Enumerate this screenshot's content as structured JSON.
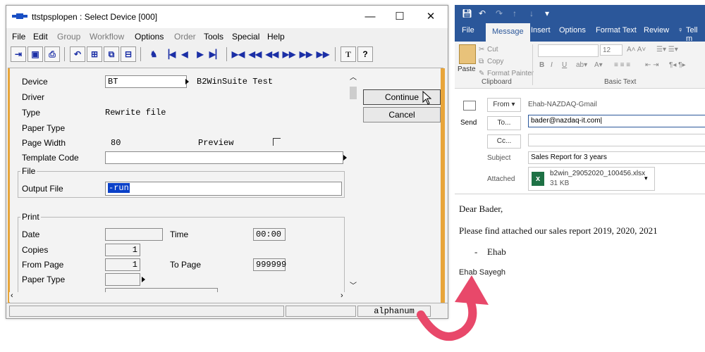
{
  "left_window": {
    "title": "ttstpsplopen : Select Device [000]",
    "controls": {
      "minimize": "—",
      "maximize": "☐",
      "close": "✕"
    },
    "menu": [
      "File",
      "Edit",
      "Group",
      "Workflow",
      "Options",
      "Order",
      "Tools",
      "Special",
      "Help"
    ],
    "toolbar_glyphs": {
      "text": "T",
      "help": "?"
    },
    "form": {
      "device_label": "Device",
      "device_value": "BT",
      "device_desc": "B2WinSuite Test",
      "driver_label": "Driver",
      "type_label": "Type",
      "type_value": "Rewrite file",
      "paper_type_label": "Paper Type",
      "page_width_label": "Page Width",
      "page_width_value": "80",
      "preview_label": "Preview",
      "template_code_label": "Template Code",
      "file_group_label": "File",
      "output_file_label": "Output File",
      "output_file_value": "-run",
      "print_group_label": "Print",
      "date_label": "Date",
      "time_label": "Time",
      "time_value": "00:00",
      "copies_label": "Copies",
      "copies_value": "1",
      "from_page_label": "From Page",
      "from_page_value": "1",
      "to_page_label": "To Page",
      "to_page_value": "999999",
      "paper_type2_label": "Paper Type"
    },
    "buttons": {
      "continue": "Continue",
      "cancel": "Cancel"
    },
    "status": {
      "mode": "alphanum"
    }
  },
  "outlook": {
    "tabs": [
      "File",
      "Message",
      "Insert",
      "Options",
      "Format Text",
      "Review",
      "Tell m"
    ],
    "active_tab": "Message",
    "ribbon": {
      "paste": "Paste",
      "cut": "Cut",
      "copy": "Copy",
      "format_painter": "Format Painter",
      "clipboard_group": "Clipboard",
      "basic_text_group": "Basic Text",
      "font_size": "12"
    },
    "header": {
      "send": "Send",
      "from_btn": "From",
      "from_value": "Ehab-NAZDAQ-Gmail",
      "to_btn": "To...",
      "to_value": "bader@nazdaq-it.com",
      "cc_btn": "Cc...",
      "subject_label": "Subject",
      "subject_value": "Sales Report for 3 years",
      "attached_label": "Attached",
      "attachment_name": "b2win_29052020_100456.xlsx",
      "attachment_size": "31 KB"
    },
    "body": {
      "greeting": "Dear Bader,",
      "line1": "Please find attached our sales report 2019, 2020, 2021",
      "bullet": "Ehab",
      "signature": "Ehab Sayegh"
    }
  },
  "colors": {
    "outlook_blue": "#2b579a",
    "accent_orange": "#e8a53a",
    "arrow_pink": "#e8486a",
    "selection": "#0a40c8"
  }
}
